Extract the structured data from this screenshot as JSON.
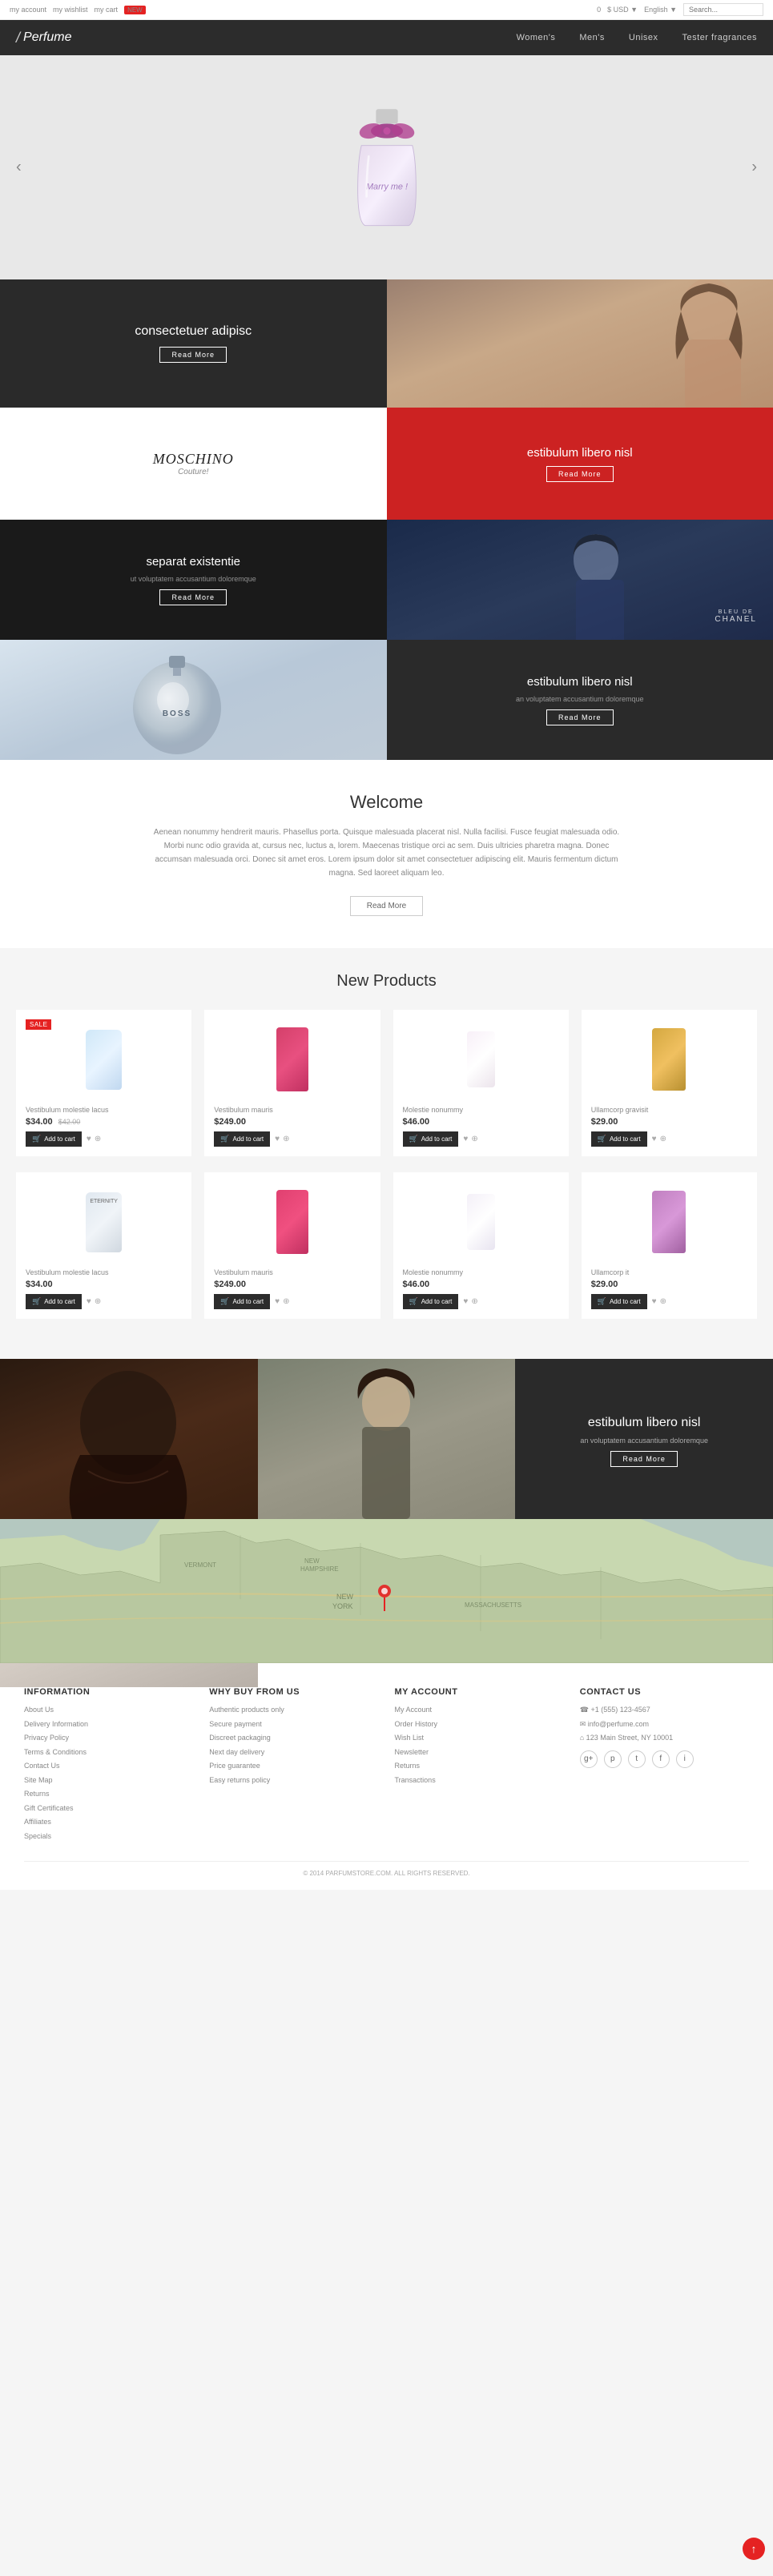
{
  "topbar": {
    "links": [
      "my account",
      "my wishlist",
      "my cart"
    ],
    "badge": "NEW",
    "cart_count": "0",
    "currency": "$ USD ▼",
    "language": "English ▼",
    "search_placeholder": "Search..."
  },
  "header": {
    "logo_slash": "/",
    "logo_text": "Perfume",
    "nav": [
      "Women's",
      "Men's",
      "Unisex",
      "Tester fragrances"
    ]
  },
  "hero": {
    "text": "Marry me !",
    "arrow_left": "‹",
    "arrow_right": "›"
  },
  "promo": {
    "cell1_title": "consectetuer adipisc",
    "cell1_btn": "Read More",
    "moschino_text": "MOSCHINO",
    "moschino_sub": "Couture!",
    "cell4_title": "estibulum libero nisl",
    "cell4_btn": "Read More",
    "cell5_title": "separat existentie",
    "cell5_sub": "ut voluptatem accusantium doloremque",
    "cell5_btn": "Read More",
    "cell8_title": "estibulum libero nisl",
    "cell8_sub": "an voluptatem accusantium doloremque",
    "cell8_btn": "Read More"
  },
  "welcome": {
    "title": "Welcome",
    "text": "Aenean nonummy hendrerit mauris. Phasellus porta. Quisque malesuada placerat nisl. Nulla facilisi. Fusce feugiat malesuada odio. Morbi nunc odio gravida at, cursus nec, luctus a, lorem. Maecenas tristique orci ac sem. Duis ultricies pharetra magna. Donec accumsan malesuada orci. Donec sit amet eros. Lorem ipsum dolor sit amet consectetuer adipiscing elit. Mauris fermentum dictum magna. Sed laoreet aliquam leo.",
    "btn": "Read More"
  },
  "new_products": {
    "title": "New Products",
    "items": [
      {
        "name": "Vestibulum molestie lacus",
        "price": "$34.00",
        "price_old": "$42.00",
        "btn": "Add to cart",
        "sale": true
      },
      {
        "name": "Vestibulum mauris",
        "price": "$249.00",
        "price_old": "",
        "btn": "Add to cart",
        "sale": false
      },
      {
        "name": "Molestie nonummy",
        "price": "$46.00",
        "price_old": "",
        "btn": "Add to cart",
        "sale": false
      },
      {
        "name": "Ullamcorp gravisit",
        "price": "$29.00",
        "price_old": "",
        "btn": "Add to cart",
        "sale": false
      },
      {
        "name": "Vestibulum molestie lacus",
        "price": "$34.00",
        "price_old": "",
        "btn": "Add to cart",
        "sale": false
      },
      {
        "name": "Vestibulum mauris",
        "price": "$249.00",
        "price_old": "",
        "btn": "Add to cart",
        "sale": false
      },
      {
        "name": "Molestie nonummy",
        "price": "$46.00",
        "price_old": "",
        "btn": "Add to cart",
        "sale": false
      },
      {
        "name": "Ullamcorp it",
        "price": "$29.00",
        "price_old": "",
        "btn": "Add to cart",
        "sale": false
      }
    ]
  },
  "bottom_promo": {
    "title": "estibulum libero nisl",
    "sub": "an voluptatem accusantium doloremque",
    "btn": "Read More"
  },
  "footer": {
    "information": {
      "title": "INFORMATION",
      "links": [
        "About Us",
        "Delivery Information",
        "Privacy Policy",
        "Terms & Conditions",
        "Contact Us",
        "Site Map",
        "Returns",
        "Gift Certificates",
        "Affiliates",
        "Specials"
      ]
    },
    "why_buy": {
      "title": "WHY BUY FROM US",
      "links": [
        "Authentic products only",
        "Secure payment",
        "Discreet packaging",
        "Next day delivery",
        "Price guarantee",
        "Easy returns policy"
      ]
    },
    "my_account": {
      "title": "MY ACCOUNT",
      "links": [
        "My Account",
        "Order History",
        "Wish List",
        "Newsletter",
        "Returns",
        "Transactions"
      ]
    },
    "contact": {
      "title": "CONTACT US",
      "items": [
        "☎ +1 (555) 123-4567",
        "✉ info@perfume.com",
        "⌂ 123 Main Street, NY 10001"
      ],
      "social": [
        "g+",
        "p",
        "t",
        "f",
        "i"
      ]
    },
    "copyright": "© 2014 PARFUMSTORE.COM. ALL RIGHTS RESERVED."
  }
}
